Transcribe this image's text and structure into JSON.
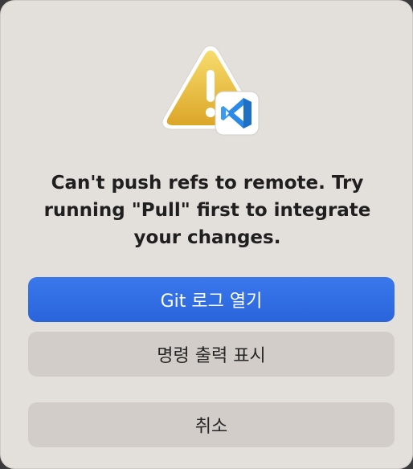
{
  "dialog": {
    "message": "Can't push refs to remote. Try running \"Pull\" first to integrate your changes.",
    "icons": {
      "main": "warning-triangle-icon",
      "badge": "vscode-icon"
    },
    "buttons": {
      "open_git_log": "Git 로그 열기",
      "show_command_output": "명령 출력 표시",
      "cancel": "취소"
    },
    "colors": {
      "background": "#e3dfdb",
      "primary_button": "#2f6de3",
      "secondary_button": "#d2cdc8",
      "warning_yellow": "#f2c94c",
      "vscode_blue": "#2b8ae8"
    }
  }
}
